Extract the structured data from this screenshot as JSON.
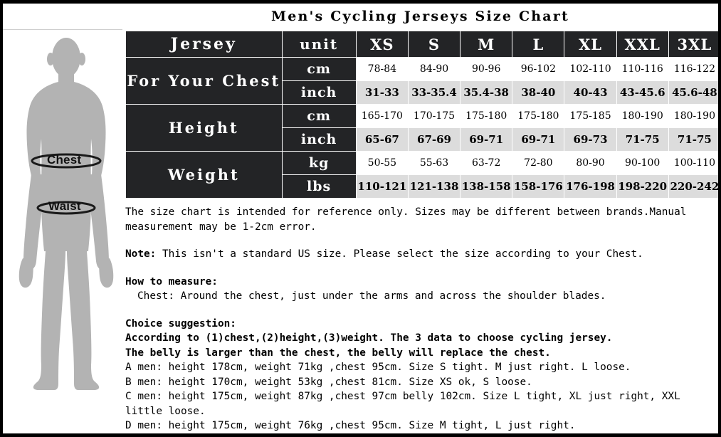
{
  "title": "Men's Cycling Jerseys Size Chart",
  "figure": {
    "chest_label": "Chest",
    "waist_label": "Waist",
    "silhouette_color": "#b3b3b3"
  },
  "table": {
    "header": {
      "name_label": "Jersey",
      "unit_label": "unit",
      "sizes": [
        "XS",
        "S",
        "M",
        "L",
        "XL",
        "XXL",
        "3XL"
      ]
    },
    "groups": [
      {
        "label": "For Your Chest",
        "rows": [
          {
            "unit": "cm",
            "style": "white",
            "values": [
              "78-84",
              "84-90",
              "90-96",
              "96-102",
              "102-110",
              "110-116",
              "116-122"
            ]
          },
          {
            "unit": "inch",
            "style": "gray",
            "values": [
              "31-33",
              "33-35.4",
              "35.4-38",
              "38-40",
              "40-43",
              "43-45.6",
              "45.6-48"
            ]
          }
        ]
      },
      {
        "label": "Height",
        "rows": [
          {
            "unit": "cm",
            "style": "white",
            "values": [
              "165-170",
              "170-175",
              "175-180",
              "175-180",
              "175-185",
              "180-190",
              "180-190"
            ]
          },
          {
            "unit": "inch",
            "style": "gray",
            "values": [
              "65-67",
              "67-69",
              "69-71",
              "69-71",
              "69-73",
              "71-75",
              "71-75"
            ]
          }
        ]
      },
      {
        "label": "Weight",
        "rows": [
          {
            "unit": "kg",
            "style": "white",
            "values": [
              "50-55",
              "55-63",
              "63-72",
              "72-80",
              "80-90",
              "90-100",
              "100-110"
            ]
          },
          {
            "unit": "lbs",
            "style": "gray",
            "values": [
              "110-121",
              "121-138",
              "138-158",
              "158-176",
              "176-198",
              "198-220",
              "220-242"
            ]
          }
        ]
      }
    ]
  },
  "notes": {
    "disclaimer_line1": "The size chart is intended for reference only. Sizes may be different between brands.Manual",
    "disclaimer_line2": "measurement may be 1-2cm error.",
    "note_label": "Note:",
    "note_text": " This isn't a standard US size. Please select the size according to your Chest.",
    "how_to_measure_heading": "How to measure:",
    "how_to_measure_chest": "Chest: Around the chest, just under the arms and across the shoulder blades.",
    "choice_heading": "Choice suggestion:",
    "choice_line1": "According to (1)chest,(2)height,(3)weight. The 3 data to choose cycling jersey.",
    "choice_line2": "The belly is larger than the chest, the belly will replace the chest.",
    "example_a": "A men: height 178cm, weight 71kg ,chest 95cm. Size S tight. M just right. L loose.",
    "example_b": "B men: height 170cm, weight 53kg ,chest 81cm. Size XS ok, S loose.",
    "example_c_line1": "C men: height 175cm, weight 87kg ,chest 97cm belly 102cm. Size L tight, XL just right, XXL",
    "example_c_line2": "little loose.",
    "example_d": "D men: height 175cm, weight 76kg ,chest 95cm. Size M tight, L just right."
  }
}
